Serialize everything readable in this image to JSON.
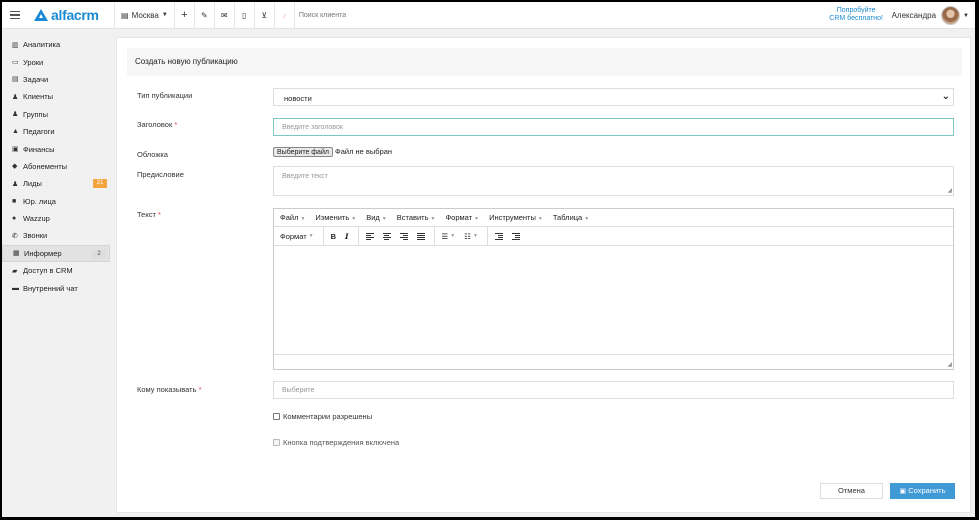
{
  "header": {
    "logo_text": "alfacrm",
    "branch": "Москва",
    "search_label": "Поиск клиента",
    "try_line1": "Попробуйте",
    "try_line2": "CRM бесплатно!",
    "user_name": "Александра"
  },
  "sidebar": {
    "items": [
      {
        "label": "Аналитика",
        "icon": "chart-icon",
        "glyph": "▥"
      },
      {
        "label": "Уроки",
        "icon": "calendar-icon",
        "glyph": "▭"
      },
      {
        "label": "Задачи",
        "icon": "clipboard-icon",
        "glyph": "▤"
      },
      {
        "label": "Клиенты",
        "icon": "user-icon",
        "glyph": "♟"
      },
      {
        "label": "Группы",
        "icon": "users-icon",
        "glyph": "♟"
      },
      {
        "label": "Педагоги",
        "icon": "graduation-cap-icon",
        "glyph": "▲"
      },
      {
        "label": "Финансы",
        "icon": "money-icon",
        "glyph": "▣"
      },
      {
        "label": "Абонементы",
        "icon": "tag-icon",
        "glyph": "◆"
      },
      {
        "label": "Лиды",
        "icon": "user-plus-icon",
        "glyph": "♟",
        "badge": "21"
      },
      {
        "label": "Юр. лица",
        "icon": "briefcase-icon",
        "glyph": "■"
      },
      {
        "label": "Wazzup",
        "icon": "whatsapp-icon",
        "glyph": "●"
      },
      {
        "label": "Звонки",
        "icon": "phone-icon",
        "glyph": "✆"
      },
      {
        "label": "Информер",
        "icon": "newspaper-icon",
        "glyph": "▦",
        "badge": "2"
      },
      {
        "label": "Доступ в CRM",
        "icon": "lock-icon",
        "glyph": "▰"
      },
      {
        "label": "Внутренний чат",
        "icon": "chat-icon",
        "glyph": "▬"
      }
    ]
  },
  "form": {
    "title": "Создать новую публикацию",
    "type_label": "Тип публикации",
    "type_value": "новости",
    "heading_label": "Заголовок",
    "heading_placeholder": "Введите заголовок",
    "cover_label": "Обложка",
    "file_button": "Выберите файл",
    "file_status": "Файл не выбран",
    "preface_label": "Предисловие",
    "preface_placeholder": "Введите текст",
    "text_label": "Текст",
    "audience_label": "Кому показывать",
    "audience_placeholder": "Выберите",
    "comments_label": "Комментарии разрешены",
    "confirm_label": "Кнопка подтверждения включена",
    "required_mark": "*",
    "cancel": "Отмена",
    "save": "Сохранить"
  },
  "editor": {
    "menus": [
      "Файл",
      "Изменить",
      "Вид",
      "Вставить",
      "Формат",
      "Инструменты",
      "Таблица"
    ],
    "format_label": "Формат",
    "bold": "B",
    "italic": "I"
  }
}
